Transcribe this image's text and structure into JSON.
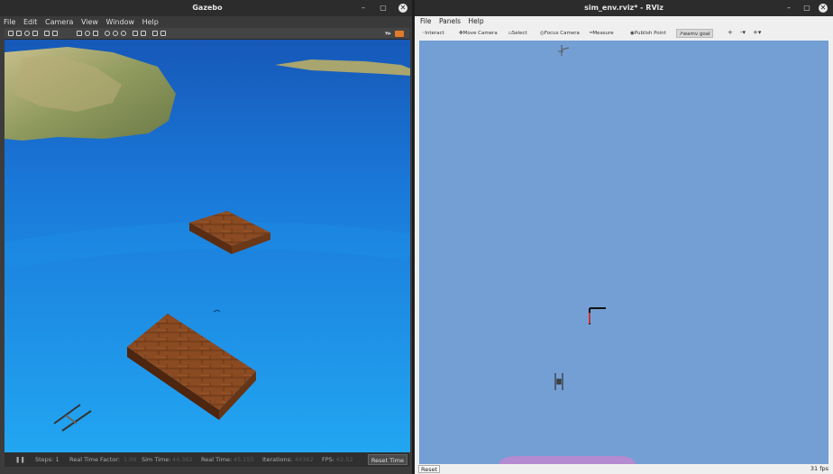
{
  "gazebo": {
    "title": "Gazebo",
    "menu": [
      "File",
      "Edit",
      "Camera",
      "View",
      "Window",
      "Help"
    ],
    "status": {
      "steps_label": "Steps: 1",
      "rtf_label": "Real Time Factor:",
      "rtf_value": "1.00",
      "sim_time_label": "Sim Time:",
      "sim_time_value": "44.362",
      "real_time_label": "Real Time:",
      "real_time_value": "45.155",
      "iterations_label": "Iterations:",
      "iterations_value": "44362",
      "fps_label": "FPS:",
      "fps_value": "62.52",
      "reset_time": "Reset Time"
    }
  },
  "rviz": {
    "title": "sim_env.rviz* - RViz",
    "menu": [
      "File",
      "Panels",
      "Help"
    ],
    "tools": {
      "interact": "Interact",
      "move_camera": "Move Camera",
      "select": "Select",
      "focus_camera": "Focus Camera",
      "measure": "Measure",
      "publish_point": "Publish Point",
      "wamv_goal": "wamv goal"
    },
    "reset": "Reset",
    "fps": "31 fps"
  },
  "colors": {
    "sea": "#1e8fe8",
    "rviz_background": "#739fd4",
    "dock_wood": "#8a4a22"
  }
}
